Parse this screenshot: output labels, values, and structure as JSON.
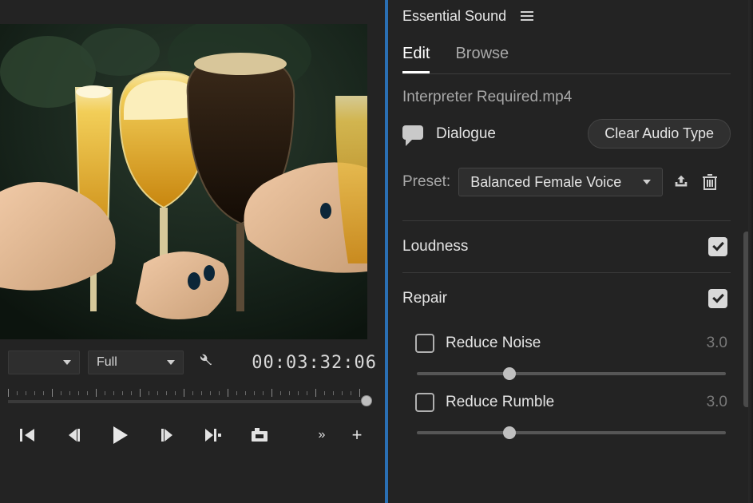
{
  "panel": {
    "title": "Essential Sound"
  },
  "tabs": {
    "edit": "Edit",
    "browse": "Browse",
    "active": "edit"
  },
  "clip": {
    "filename": "Interpreter Required.mp4"
  },
  "audioType": {
    "label": "Dialogue",
    "clear_label": "Clear Audio Type"
  },
  "preset": {
    "label": "Preset:",
    "value": "Balanced Female Voice"
  },
  "loudness": {
    "label": "Loudness"
  },
  "repair": {
    "label": "Repair",
    "reduce_noise": {
      "label": "Reduce Noise",
      "value": "3.0",
      "pos_pct": 30
    },
    "reduce_rumble": {
      "label": "Reduce Rumble",
      "value": "3.0",
      "pos_pct": 30
    }
  },
  "monitor": {
    "resolution_label": "Full",
    "timecode": "00:03:32:06"
  }
}
